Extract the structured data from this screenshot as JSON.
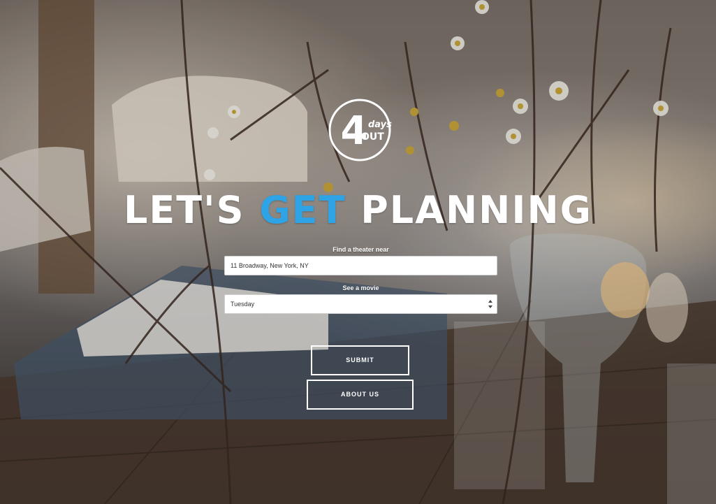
{
  "logo": {
    "number": "4",
    "word_top": "days",
    "word_bottom": "OUT"
  },
  "headline": {
    "part1": "LET'S ",
    "accent": "GET",
    "part2": " PLANNING",
    "accent_color": "#2ea3e6"
  },
  "form": {
    "theater_label": "Find a theater near",
    "theater_value": "11 Broadway, New York, NY",
    "movie_label": "See a movie",
    "movie_selected": "Tuesday"
  },
  "buttons": {
    "submit": "SUBMIT",
    "about": "ABOUT US"
  },
  "icons": {
    "logo": "4-days-out-logo-icon",
    "select": "select-arrows-icon"
  }
}
